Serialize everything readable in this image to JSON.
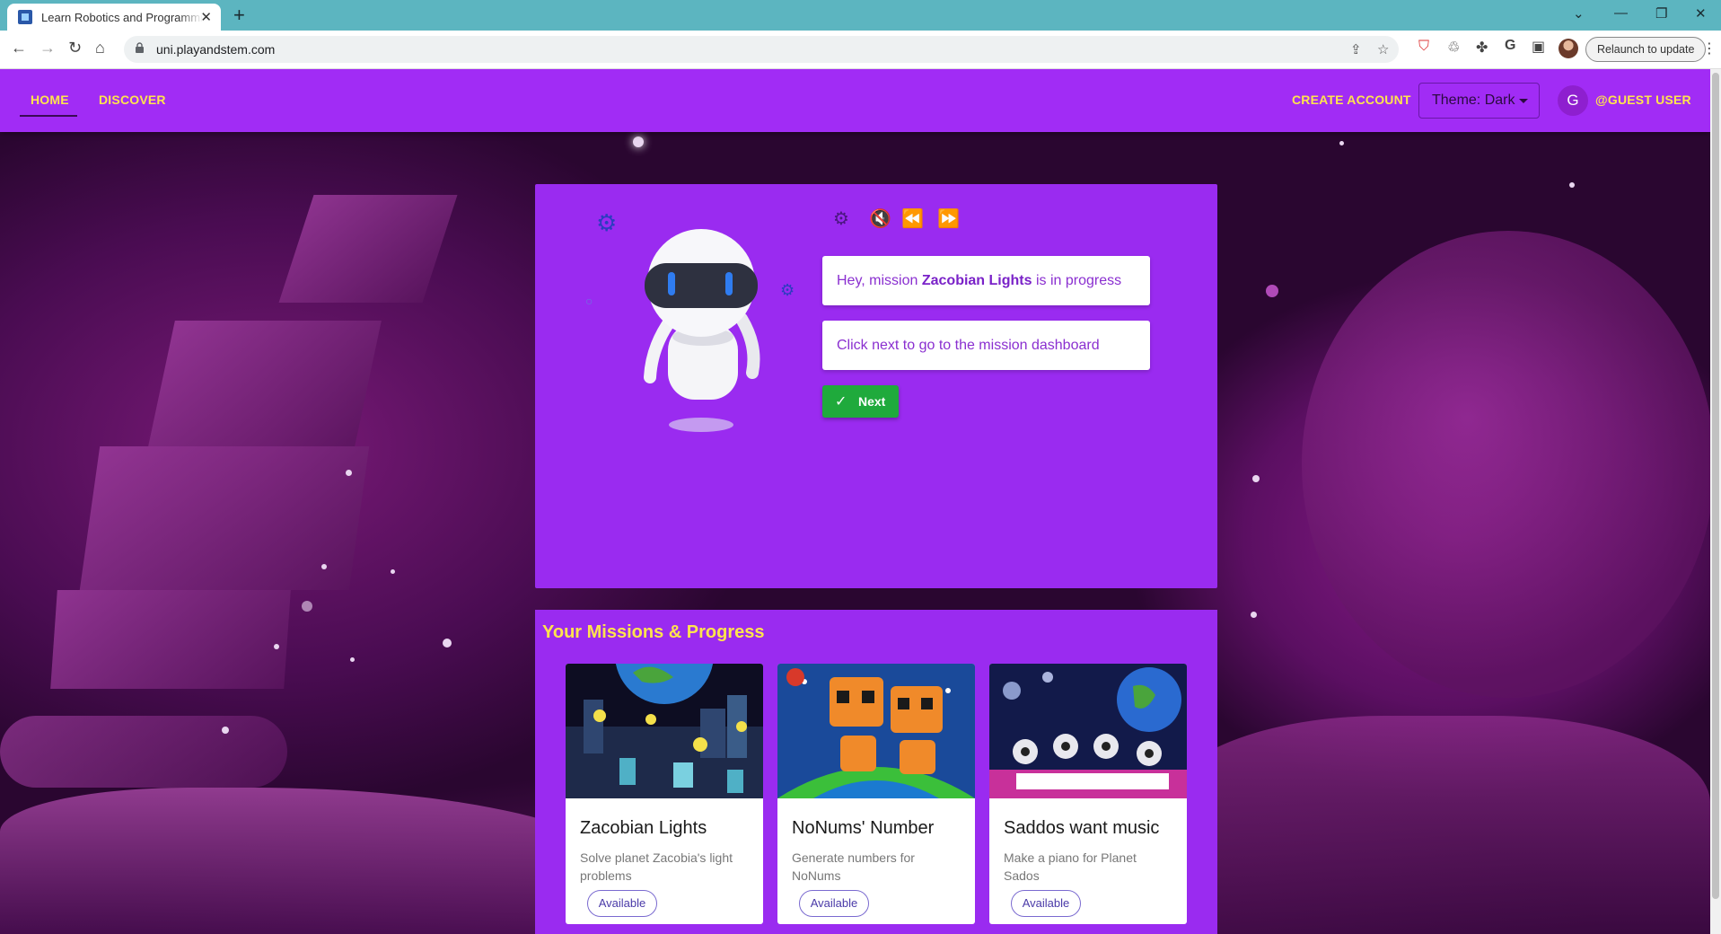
{
  "browser": {
    "tab_title": "Learn Robotics and Programmin",
    "tab_close": "✕",
    "new_tab": "+",
    "url": "uni.playandstem.com",
    "relaunch_label": "Relaunch to update"
  },
  "appbar": {
    "nav": [
      {
        "label": "HOME"
      },
      {
        "label": "DISCOVER"
      }
    ],
    "create_account": "CREATE ACCOUNT",
    "theme_select": "Theme: Dark",
    "avatar_letter": "G",
    "user_name": "@GUEST USER"
  },
  "assistant": {
    "bubble1_prefix": "Hey, mission ",
    "bubble1_mission": "Zacobian Lights",
    "bubble1_suffix": " is in progress",
    "bubble2": "Click next to go to the mission dashboard",
    "next_label": "Next"
  },
  "missions": {
    "title": "Your Missions & Progress",
    "cards": [
      {
        "title": "Zacobian Lights",
        "description": "Solve planet Zacobia's light problems",
        "status": "Available"
      },
      {
        "title": "NoNums' Number",
        "description": "Generate numbers for NoNums",
        "status": "Available"
      },
      {
        "title": "Saddos want music",
        "description": "Make a piano for Planet Sados",
        "status": "Available"
      }
    ]
  },
  "colors": {
    "appbar": "#a12cf5",
    "accent_yellow": "#ffe44d",
    "next_green": "#1faa3c",
    "browser_tab_strip": "#5cb5c0"
  }
}
